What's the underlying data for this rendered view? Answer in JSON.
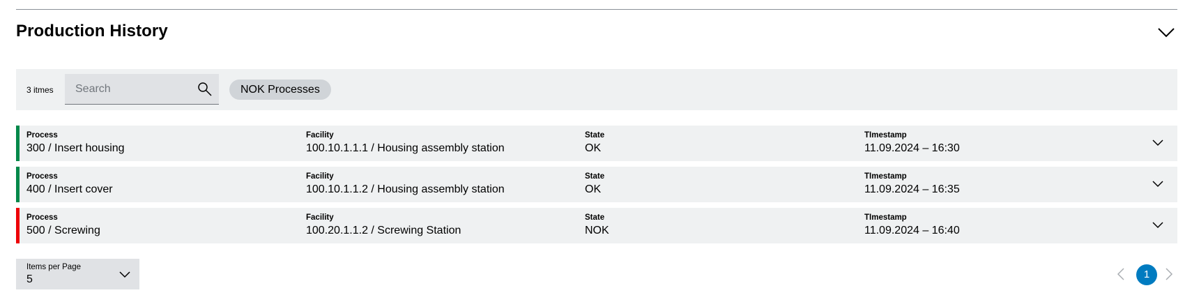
{
  "section": {
    "title": "Production History",
    "toggle_icon": "chevron-down-icon"
  },
  "toolbar": {
    "item_count": "3 itmes",
    "search": {
      "placeholder": "Search",
      "value": "",
      "icon": "search-icon"
    },
    "filter_chip": "NOK Processes"
  },
  "table": {
    "labels": {
      "process": "Process",
      "facility": "Facility",
      "state": "State",
      "timestamp": "TImestamp"
    },
    "rows": [
      {
        "process": "300 / Insert housing",
        "facility": "100.10.1.1.1 / Housing assembly station",
        "state": "OK",
        "timestamp": "11.09.2024 – 16:30",
        "status_color": "#00884a"
      },
      {
        "process": "400 / Insert cover",
        "facility": "100.10.1.1.2 / Housing assembly station",
        "state": "OK",
        "timestamp": "11.09.2024 – 16:35",
        "status_color": "#00884a"
      },
      {
        "process": "500 / Screwing",
        "facility": "100.20.1.1.2 / Screwing Station",
        "state": "NOK",
        "timestamp": "11.09.2024 – 16:40",
        "status_color": "#ed0007"
      }
    ]
  },
  "pagination": {
    "items_per_page_label": "Items per Page",
    "items_per_page_value": "5",
    "current_page": "1",
    "prev_icon": "chevron-left-icon",
    "next_icon": "chevron-right-icon"
  },
  "colors": {
    "ok": "#00884a",
    "nok": "#ed0007",
    "accent": "#007bc0",
    "row_bg": "#eff1f2"
  }
}
